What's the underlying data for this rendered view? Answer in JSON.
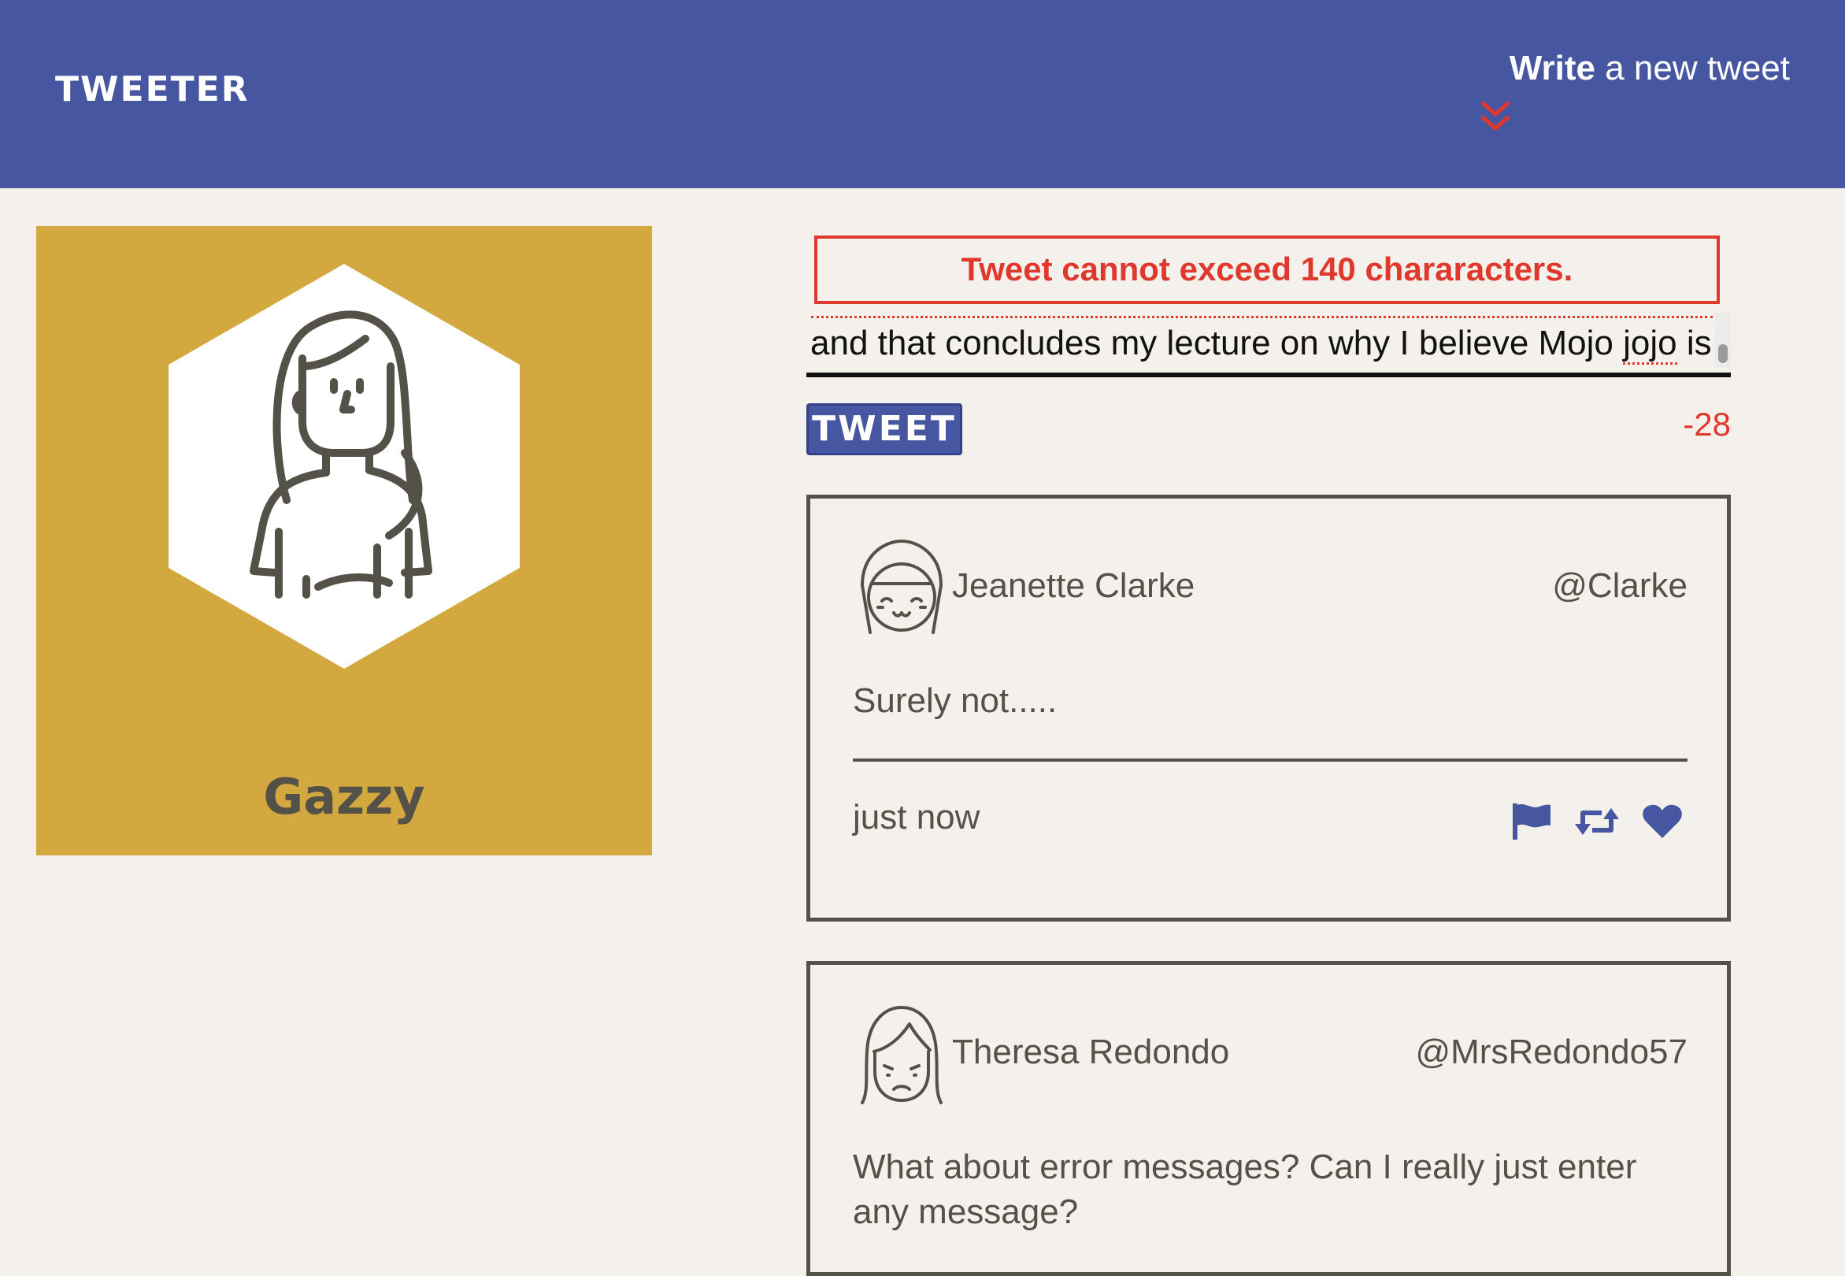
{
  "nav": {
    "brand": "TWEETER",
    "compose_bold": "Write",
    "compose_rest": " a new tweet"
  },
  "profile": {
    "name": "Gazzy",
    "background_color": "#d3a83e"
  },
  "compose": {
    "error": "Tweet cannot exceed 140 chararacters.",
    "input_before": "and that concludes my lecture on why I believe Mojo ",
    "input_misspelled": "jojo",
    "input_after": " is",
    "button_label": "TWEET",
    "counter": "-28"
  },
  "tweets": [
    {
      "name": "Jeanette Clarke",
      "handle": "@Clarke",
      "content": "Surely not.....",
      "time": "just now"
    },
    {
      "name": "Theresa Redondo",
      "handle": "@MrsRedondo57",
      "content": "What about error messages? Can I really just enter any message?"
    }
  ],
  "colors": {
    "nav": "#4656a0",
    "accent_red": "#e0382c",
    "text": "#545149",
    "page_bg": "#f4f1ec"
  },
  "icons": {
    "compose_toggle": "double-chevron-down-icon",
    "flag": "flag-icon",
    "retweet": "retweet-icon",
    "like": "heart-icon"
  }
}
